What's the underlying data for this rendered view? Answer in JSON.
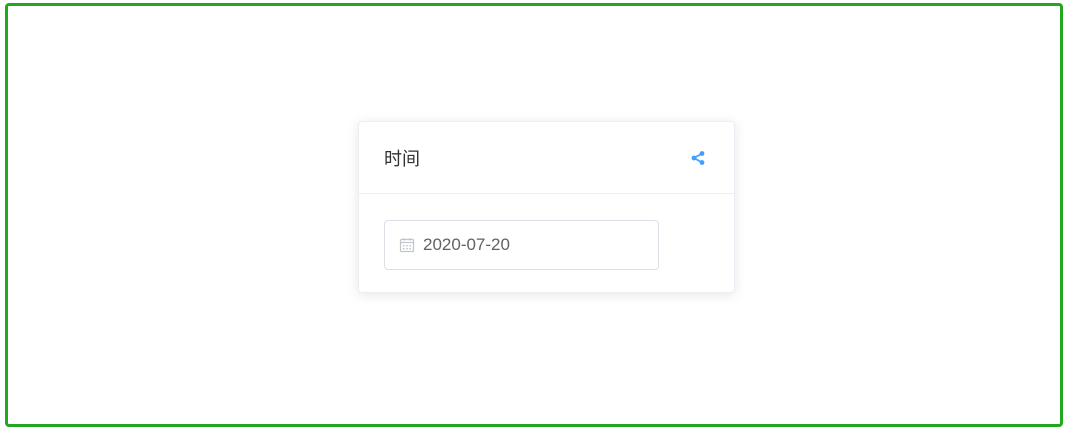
{
  "card": {
    "title": "时间",
    "share_icon": "share-icon"
  },
  "date_picker": {
    "value": "2020-07-20",
    "icon": "calendar-icon"
  },
  "colors": {
    "frame_border": "#22a71f",
    "accent": "#409eff",
    "text_primary": "#303133",
    "text_regular": "#606266",
    "border": "#dcdfe6",
    "icon_muted": "#c0c4cc"
  }
}
